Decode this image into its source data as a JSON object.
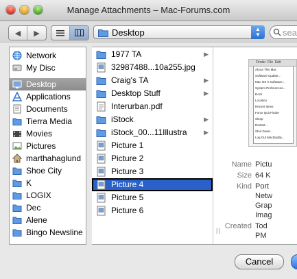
{
  "window": {
    "title": "Manage Attachments – Mac-Forums.com"
  },
  "toolbar": {
    "back_icon": "back-arrow-icon",
    "forward_icon": "forward-arrow-icon",
    "location": "Desktop",
    "search_placeholder": "sea"
  },
  "sidebar": {
    "devices": [
      {
        "label": "Network",
        "icon": "globe-icon"
      },
      {
        "label": "My Disc",
        "icon": "disk-icon"
      }
    ],
    "places": [
      {
        "label": "Desktop",
        "icon": "desktop-icon"
      },
      {
        "label": "Applications",
        "icon": "applications-icon"
      },
      {
        "label": "Documents",
        "icon": "documents-icon"
      },
      {
        "label": "Tierra Media",
        "icon": "folder-icon"
      },
      {
        "label": "Movies",
        "icon": "movies-icon"
      },
      {
        "label": "Pictures",
        "icon": "pictures-icon"
      },
      {
        "label": "marthahaglund",
        "icon": "home-icon"
      },
      {
        "label": "Shoe City",
        "icon": "folder-icon"
      },
      {
        "label": "K",
        "icon": "folder-icon"
      },
      {
        "label": "LOGIX",
        "icon": "folder-icon"
      },
      {
        "label": "Dec",
        "icon": "folder-icon"
      },
      {
        "label": "Alene",
        "icon": "folder-icon"
      },
      {
        "label": "Bingo Newsline",
        "icon": "folder-icon"
      }
    ]
  },
  "files": [
    {
      "label": "1977 TA",
      "type": "folder"
    },
    {
      "label": "32987488...10a255.jpg",
      "type": "image"
    },
    {
      "label": "Craig's TA",
      "type": "folder"
    },
    {
      "label": "Desktop Stuff",
      "type": "folder"
    },
    {
      "label": "Interurban.pdf",
      "type": "document"
    },
    {
      "label": "iStock",
      "type": "folder"
    },
    {
      "label": "iStock_00...11Illustra",
      "type": "folder"
    },
    {
      "label": "Picture 1",
      "type": "image"
    },
    {
      "label": "Picture 2",
      "type": "image"
    },
    {
      "label": "Picture 3",
      "type": "image"
    },
    {
      "label": "Picture 4",
      "type": "image"
    },
    {
      "label": "Picture 5",
      "type": "image"
    },
    {
      "label": "Picture 6",
      "type": "image"
    }
  ],
  "selected_file": "Picture 4",
  "info": {
    "name_label": "Name",
    "name_value": "Pictu",
    "size_label": "Size",
    "size_value": "64 K",
    "kind_label": "Kind",
    "kind_value": "Port",
    "kind_extra": [
      "Netw",
      "Grap",
      "Imag"
    ],
    "created_label": "Created",
    "created_value": "Tod",
    "created_extra": "PM"
  },
  "preview_menu": {
    "bar": [
      "Finder",
      "File",
      "Edit"
    ],
    "items": [
      "About This Mac",
      "Software Update...",
      "Mac OS X Software...",
      "System Preferences...",
      "Dock",
      "Location",
      "Recent Items",
      "Force Quit Finder",
      "Sleep",
      "Restart...",
      "Shut Down...",
      "Log Out MacDaddy..."
    ]
  },
  "buttons": {
    "cancel": "Cancel"
  },
  "colors": {
    "selection": "#2a61c9",
    "sidebar_selection": "#999999",
    "folder": "#5e9be6"
  }
}
